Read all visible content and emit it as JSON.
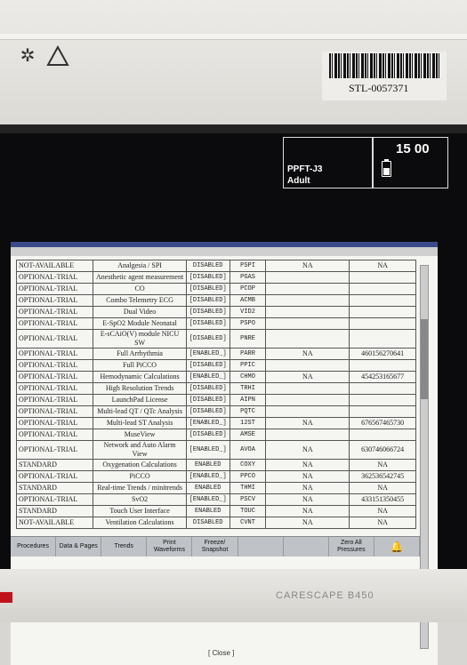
{
  "device": {
    "asset_tag": "STL-0057371",
    "brand": "CARESCAPE B450"
  },
  "patient": {
    "name": "PPFT-J3",
    "category": "Adult",
    "time": "15 00"
  },
  "feature_table": {
    "rows": [
      {
        "status": "NOT-AVAILABLE",
        "name": "Analgesia / SPI",
        "enabled": "DISABLED",
        "code": "PSPI",
        "col5": "NA",
        "col6": "NA"
      },
      {
        "status": "OPTIONAL-TRIAL",
        "name": "Anesthetic agent measurement",
        "enabled": "[DISABLED]",
        "code": "PGAS",
        "col5": "",
        "col6": ""
      },
      {
        "status": "OPTIONAL-TRIAL",
        "name": "CO",
        "enabled": "[DISABLED]",
        "code": "PCOP",
        "col5": "",
        "col6": ""
      },
      {
        "status": "OPTIONAL-TRIAL",
        "name": "Combo Telemetry ECG",
        "enabled": "[DISABLED]",
        "code": "ACMB",
        "col5": "",
        "col6": ""
      },
      {
        "status": "OPTIONAL-TRIAL",
        "name": "Dual Video",
        "enabled": "[DISABLED]",
        "code": "VID2",
        "col5": "",
        "col6": ""
      },
      {
        "status": "OPTIONAL-TRIAL",
        "name": "E-SpO2 Module Neonatal",
        "enabled": "[DISABLED]",
        "code": "PSPO",
        "col5": "",
        "col6": ""
      },
      {
        "status": "OPTIONAL-TRIAL",
        "name": "E-sCAiO(V) module NICU SW",
        "enabled": "[DISABLED]",
        "code": "PNRE",
        "col5": "",
        "col6": ""
      },
      {
        "status": "OPTIONAL-TRIAL",
        "name": "Full Arrhythmia",
        "enabled": "[ENABLED_]",
        "code": "PARR",
        "col5": "NA",
        "col6": "460156270641"
      },
      {
        "status": "OPTIONAL-TRIAL",
        "name": "Full PiCCO",
        "enabled": "[DISABLED]",
        "code": "PPIC",
        "col5": "",
        "col6": ""
      },
      {
        "status": "OPTIONAL-TRIAL",
        "name": "Hemodynamic Calculations",
        "enabled": "[ENABLED_]",
        "code": "CHMO",
        "col5": "NA",
        "col6": "454253165677"
      },
      {
        "status": "OPTIONAL-TRIAL",
        "name": "High Resolution Trends",
        "enabled": "[DISABLED]",
        "code": "TRHI",
        "col5": "",
        "col6": ""
      },
      {
        "status": "OPTIONAL-TRIAL",
        "name": "LaunchPad License",
        "enabled": "[DISABLED]",
        "code": "AIPN",
        "col5": "",
        "col6": ""
      },
      {
        "status": "OPTIONAL-TRIAL",
        "name": "Multi-lead QT / QTc Analysis",
        "enabled": "[DISABLED]",
        "code": "PQTC",
        "col5": "",
        "col6": ""
      },
      {
        "status": "OPTIONAL-TRIAL",
        "name": "Multi-lead ST Analysis",
        "enabled": "[ENABLED_]",
        "code": "12ST",
        "col5": "NA",
        "col6": "676567465730"
      },
      {
        "status": "OPTIONAL-TRIAL",
        "name": "MuseView",
        "enabled": "[DISABLED]",
        "code": "AMSE",
        "col5": "",
        "col6": ""
      },
      {
        "status": "OPTIONAL-TRIAL",
        "name": "Network and Auto Alarm View",
        "enabled": "[ENABLED_]",
        "code": "AVOA",
        "col5": "NA",
        "col6": "630746066724"
      },
      {
        "status": "STANDARD",
        "name": "Oxygenation Calculations",
        "enabled": "ENABLED",
        "code": "COXY",
        "col5": "NA",
        "col6": "NA"
      },
      {
        "status": "OPTIONAL-TRIAL",
        "name": "PiCCO",
        "enabled": "[ENABLED_]",
        "code": "PPCO",
        "col5": "NA",
        "col6": "362536542745"
      },
      {
        "status": "STANDARD",
        "name": "Real-time Trends / minitrends",
        "enabled": "ENABLED",
        "code": "THMI",
        "col5": "NA",
        "col6": "NA"
      },
      {
        "status": "OPTIONAL-TRIAL",
        "name": "SvO2",
        "enabled": "[ENABLED_]",
        "code": "PSCV",
        "col5": "NA",
        "col6": "433151350455"
      },
      {
        "status": "STANDARD",
        "name": "Touch User Interface",
        "enabled": "ENABLED",
        "code": "TOUC",
        "col5": "NA",
        "col6": "NA"
      },
      {
        "status": "NOT-AVAILABLE",
        "name": "Ventilation Calculations",
        "enabled": "DISABLED",
        "code": "CVNT",
        "col5": "NA",
        "col6": "NA"
      }
    ]
  },
  "close_label": "[ Close ]",
  "toolbar": {
    "procedures": "Procedures",
    "data_pages": "Data & Pages",
    "trends": "Trends",
    "print": "Print Waveforms",
    "freeze": "Freeze/ Snapshot",
    "blank1": "",
    "blank2": "",
    "zero": "Zero All Pressures"
  }
}
